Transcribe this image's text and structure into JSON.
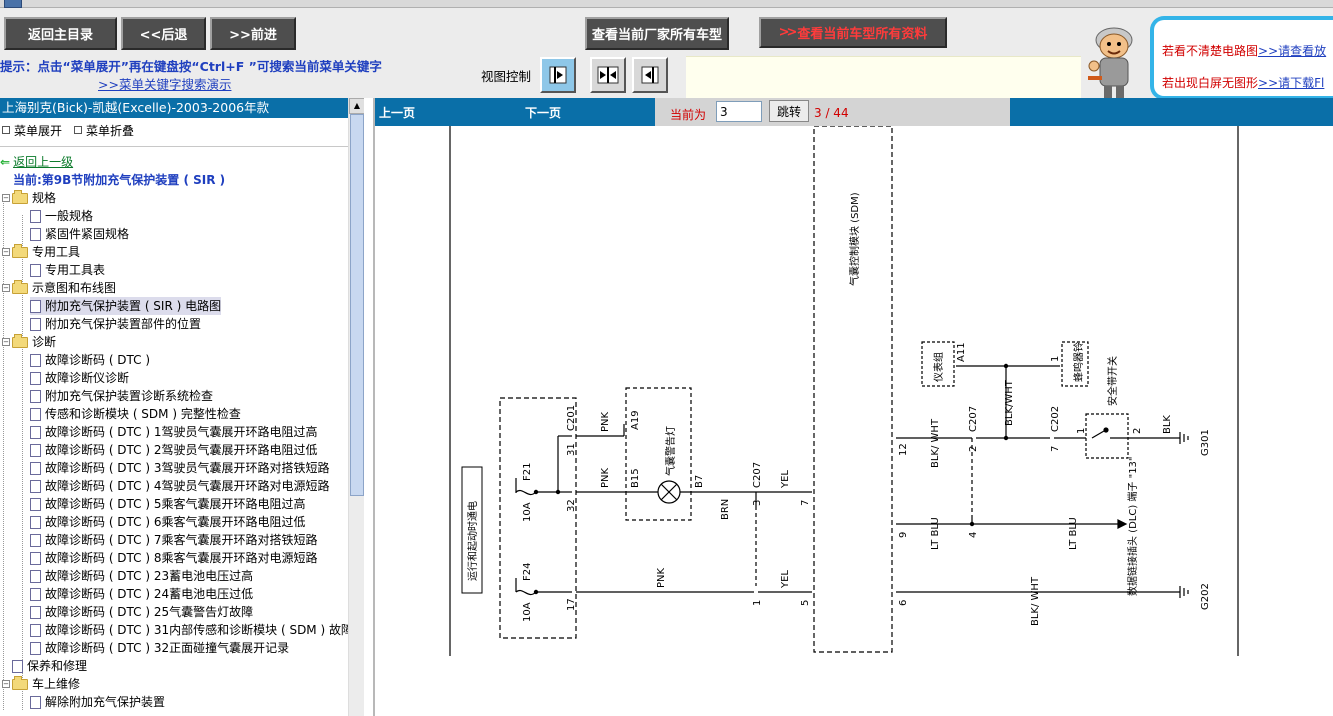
{
  "toolbar": {
    "home": "返回主目录",
    "back": "<<后退",
    "forward": ">>前进",
    "manufacturer_models": "查看当前厂家所有车型",
    "all_data": "查看当前车型所有资料",
    "hint": "提示：点击“菜单展开”再在键盘按“Ctrl+F ”可搜索当前菜单关键字",
    "hint_link": ">>菜单关键字搜索演示",
    "view_control": "视图控制"
  },
  "help": {
    "line1_text": "若看不清楚电路图",
    "line1_link": ">>请查看放",
    "line2_text": "若出现白屏无图形",
    "line2_link": ">>请下载Fl"
  },
  "sidebar": {
    "title": "上海别克(Bick)-凯越(Excelle)-2003-2006年款",
    "expand": "菜单展开",
    "collapse": "菜单折叠",
    "back_up": "返回上一级",
    "current": "当前:第9B节附加充气保护装置 ( SIR )",
    "tree": [
      {
        "type": "folder",
        "level": 1,
        "label": "规格"
      },
      {
        "type": "page",
        "level": 2,
        "label": "一般规格"
      },
      {
        "type": "page",
        "level": 2,
        "label": "紧固件紧固规格"
      },
      {
        "type": "folder",
        "level": 1,
        "label": "专用工具"
      },
      {
        "type": "page",
        "level": 2,
        "label": "专用工具表"
      },
      {
        "type": "folder",
        "level": 1,
        "label": "示意图和布线图"
      },
      {
        "type": "page",
        "level": 2,
        "label": "附加充气保护装置 ( SIR ) 电路图",
        "selected": true
      },
      {
        "type": "page",
        "level": 2,
        "label": "附加充气保护装置部件的位置"
      },
      {
        "type": "folder",
        "level": 1,
        "label": "诊断"
      },
      {
        "type": "page",
        "level": 2,
        "label": "故障诊断码 ( DTC )"
      },
      {
        "type": "page",
        "level": 2,
        "label": "故障诊断仪诊断"
      },
      {
        "type": "page",
        "level": 2,
        "label": "附加充气保护装置诊断系统检查"
      },
      {
        "type": "page",
        "level": 2,
        "label": "传感和诊断模块 ( SDM ) 完整性检查"
      },
      {
        "type": "page",
        "level": 2,
        "label": "故障诊断码 ( DTC ) 1驾驶员气囊展开环路电阻过高"
      },
      {
        "type": "page",
        "level": 2,
        "label": "故障诊断码 ( DTC ) 2驾驶员气囊展开环路电阻过低"
      },
      {
        "type": "page",
        "level": 2,
        "label": "故障诊断码 ( DTC ) 3驾驶员气囊展开环路对搭铁短路"
      },
      {
        "type": "page",
        "level": 2,
        "label": "故障诊断码 ( DTC ) 4驾驶员气囊展开环路对电源短路"
      },
      {
        "type": "page",
        "level": 2,
        "label": "故障诊断码 ( DTC ) 5乘客气囊展开环路电阻过高"
      },
      {
        "type": "page",
        "level": 2,
        "label": "故障诊断码 ( DTC ) 6乘客气囊展开环路电阻过低"
      },
      {
        "type": "page",
        "level": 2,
        "label": "故障诊断码 ( DTC ) 7乘客气囊展开环路对搭铁短路"
      },
      {
        "type": "page",
        "level": 2,
        "label": "故障诊断码 ( DTC ) 8乘客气囊展开环路对电源短路"
      },
      {
        "type": "page",
        "level": 2,
        "label": "故障诊断码 ( DTC ) 23蓄电池电压过高"
      },
      {
        "type": "page",
        "level": 2,
        "label": "故障诊断码 ( DTC ) 24蓄电池电压过低"
      },
      {
        "type": "page",
        "level": 2,
        "label": "故障诊断码 ( DTC ) 25气囊警告灯故障"
      },
      {
        "type": "page",
        "level": 2,
        "label": "故障诊断码 ( DTC ) 31内部传感和诊断模块 ( SDM ) 故障"
      },
      {
        "type": "page",
        "level": 2,
        "label": "故障诊断码 ( DTC ) 32正面碰撞气囊展开记录"
      },
      {
        "type": "page",
        "level": 1,
        "label": "保养和修理"
      },
      {
        "type": "folder",
        "level": 1,
        "label": "车上维修"
      },
      {
        "type": "page",
        "level": 2,
        "label": "解除附加充气保护装置"
      }
    ]
  },
  "pager": {
    "prev": "上一页",
    "next": "下一页",
    "current_label": "当前为",
    "current_value": "3",
    "go": "跳转",
    "count": "3 / 44"
  },
  "diagram": {
    "run_start_power": "运行和起动时通电",
    "sdm": "气囊控制模块 (SDM)",
    "fuse_top": "F21",
    "fuse_top_rating": "10A",
    "fuse_bot": "F24",
    "fuse_bot_rating": "10A",
    "pin_31": "31",
    "c201": "C201",
    "pin_32": "32",
    "pin_17": "17",
    "pnk_top": "PNK",
    "pnk_mid": "PNK",
    "pnk_bot": "PNK",
    "a19": "A19",
    "b15": "B15",
    "b7": "B7",
    "lamp": "气囊警告灯",
    "brn": "BRN",
    "c207_left": "C207",
    "pin_3": "3",
    "pin_1": "1",
    "yel_top": "YEL",
    "yel_bot": "YEL",
    "pin_7": "7",
    "pin_5": "5",
    "cluster": "仪表组",
    "a11": "A11",
    "buzzer": "蜂鸣器铃",
    "buzzer_pin": "1",
    "seatbelt": "安全带开关",
    "blk_wht_top": "BLK/WHT",
    "c207_right": "C207",
    "pin_2": "2",
    "c202": "C202",
    "pin_7b": "7",
    "sw_pin1": "1",
    "sw_pin2": "2",
    "blk": "BLK",
    "g301": "G301",
    "pin_12": "12",
    "blk_wht_left": "BLK/ WHT",
    "pin_9": "9",
    "lt_blu_1": "LT BLU",
    "pin_4": "4",
    "lt_blu_2": "LT BLU",
    "dlc": "数据链接插头 (DLC) 端子 \"13\"",
    "pin_6": "6",
    "blk_wht_bot": "BLK/ WHT",
    "g202": "G202"
  }
}
